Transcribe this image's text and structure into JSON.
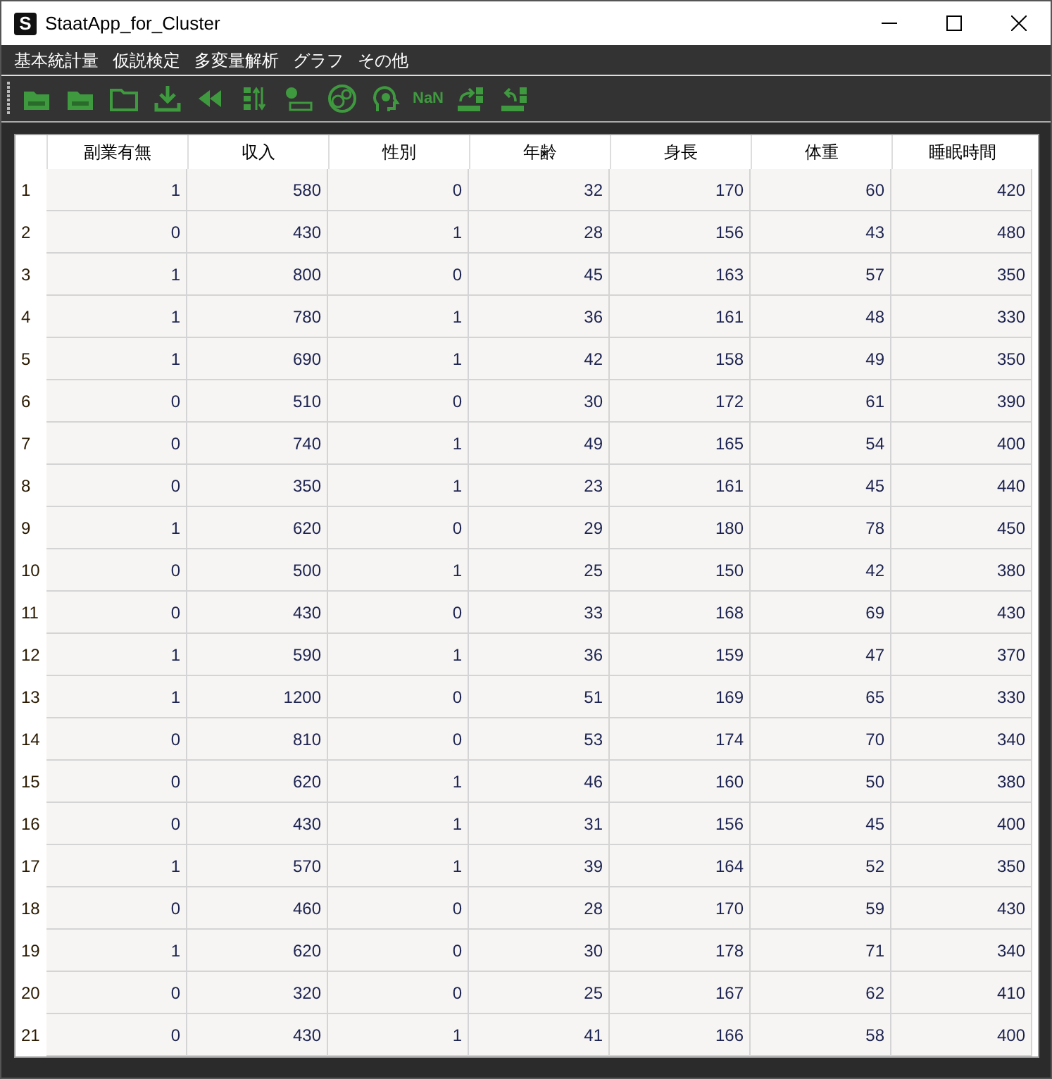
{
  "window": {
    "title": "StaatApp_for_Cluster",
    "app_icon_letter": "S"
  },
  "menu": [
    "基本統計量",
    "仮説検定",
    "多変量解析",
    "グラフ",
    "その他"
  ],
  "toolbar": [
    {
      "kind": "icon"
    },
    {
      "kind": "icon"
    },
    {
      "kind": "icon"
    },
    {
      "kind": "icon"
    },
    {
      "kind": "icon"
    },
    {
      "kind": "icon"
    },
    {
      "kind": "icon"
    },
    {
      "kind": "icon"
    },
    {
      "kind": "icon"
    },
    {
      "kind": "text",
      "label": "NaN"
    },
    {
      "kind": "icon"
    },
    {
      "kind": "icon"
    }
  ],
  "table": {
    "columns": [
      "副業有無",
      "収入",
      "性別",
      "年齢",
      "身長",
      "体重",
      "睡眠時間"
    ],
    "rows": [
      {
        "label": "1",
        "cells": [
          "1",
          "580",
          "0",
          "32",
          "170",
          "60",
          "420"
        ]
      },
      {
        "label": "2",
        "cells": [
          "0",
          "430",
          "1",
          "28",
          "156",
          "43",
          "480"
        ]
      },
      {
        "label": "3",
        "cells": [
          "1",
          "800",
          "0",
          "45",
          "163",
          "57",
          "350"
        ]
      },
      {
        "label": "4",
        "cells": [
          "1",
          "780",
          "1",
          "36",
          "161",
          "48",
          "330"
        ]
      },
      {
        "label": "5",
        "cells": [
          "1",
          "690",
          "1",
          "42",
          "158",
          "49",
          "350"
        ]
      },
      {
        "label": "6",
        "cells": [
          "0",
          "510",
          "0",
          "30",
          "172",
          "61",
          "390"
        ]
      },
      {
        "label": "7",
        "cells": [
          "0",
          "740",
          "1",
          "49",
          "165",
          "54",
          "400"
        ]
      },
      {
        "label": "8",
        "cells": [
          "0",
          "350",
          "1",
          "23",
          "161",
          "45",
          "440"
        ]
      },
      {
        "label": "9",
        "cells": [
          "1",
          "620",
          "0",
          "29",
          "180",
          "78",
          "450"
        ]
      },
      {
        "label": "10",
        "cells": [
          "0",
          "500",
          "1",
          "25",
          "150",
          "42",
          "380"
        ]
      },
      {
        "label": "11",
        "cells": [
          "0",
          "430",
          "0",
          "33",
          "168",
          "69",
          "430"
        ]
      },
      {
        "label": "12",
        "cells": [
          "1",
          "590",
          "1",
          "36",
          "159",
          "47",
          "370"
        ]
      },
      {
        "label": "13",
        "cells": [
          "1",
          "1200",
          "0",
          "51",
          "169",
          "65",
          "330"
        ]
      },
      {
        "label": "14",
        "cells": [
          "0",
          "810",
          "0",
          "53",
          "174",
          "70",
          "340"
        ]
      },
      {
        "label": "15",
        "cells": [
          "0",
          "620",
          "1",
          "46",
          "160",
          "50",
          "380"
        ]
      },
      {
        "label": "16",
        "cells": [
          "0",
          "430",
          "1",
          "31",
          "156",
          "45",
          "400"
        ]
      },
      {
        "label": "17",
        "cells": [
          "1",
          "570",
          "1",
          "39",
          "164",
          "52",
          "350"
        ]
      },
      {
        "label": "18",
        "cells": [
          "0",
          "460",
          "0",
          "28",
          "170",
          "59",
          "430"
        ]
      },
      {
        "label": "19",
        "cells": [
          "1",
          "620",
          "0",
          "30",
          "178",
          "71",
          "340"
        ]
      },
      {
        "label": "20",
        "cells": [
          "0",
          "320",
          "0",
          "25",
          "167",
          "62",
          "410"
        ]
      },
      {
        "label": "21",
        "cells": [
          "0",
          "430",
          "1",
          "41",
          "166",
          "58",
          "400"
        ]
      }
    ]
  }
}
